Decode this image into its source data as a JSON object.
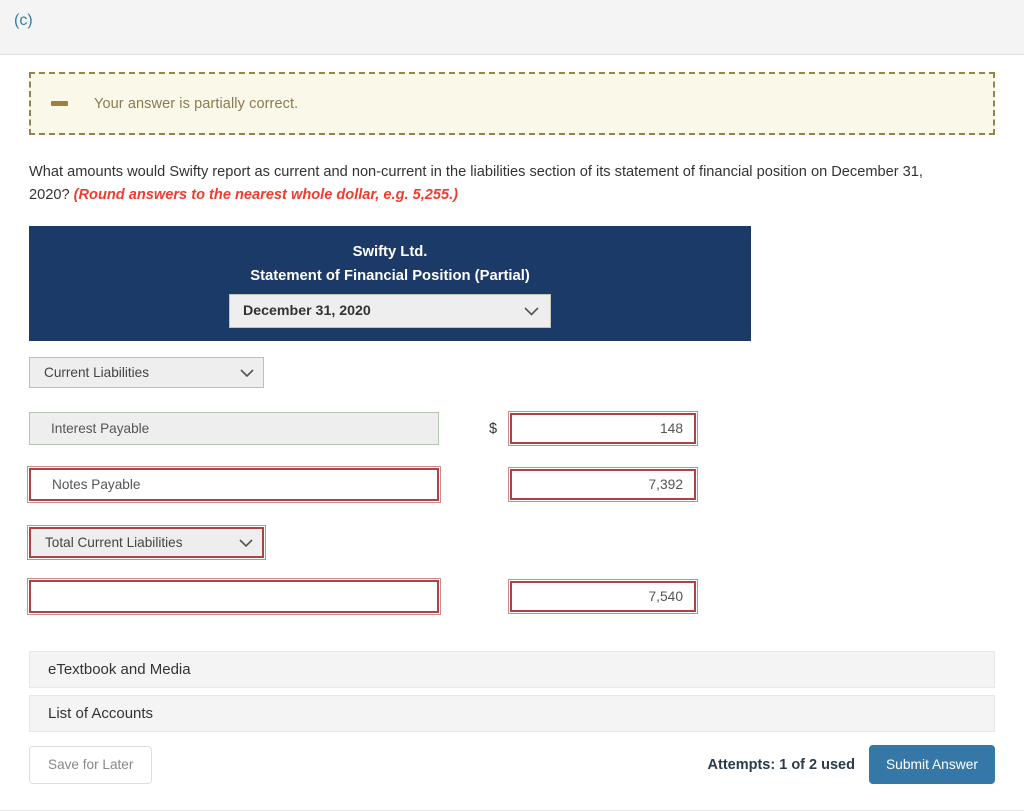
{
  "part_label": "(c)",
  "alert": {
    "icon": "minus-icon",
    "message": "Your answer is partially correct.",
    "border_color": "#96854b",
    "background_color": "#faf8e8"
  },
  "question": {
    "text": "What amounts would Swifty report as current and non-current in the liabilities section of its statement of financial position on December 31, 2020? ",
    "emphasis": "(Round answers to the nearest whole dollar, e.g. 5,255.)",
    "emphasis_color": "#ef3c2d"
  },
  "statement": {
    "company": "Swifty Ltd.",
    "title": "Statement of Financial Position (Partial)",
    "header_color": "#1b3a68",
    "date_select": {
      "value": "December 31, 2020",
      "icon": "chevron-down-icon"
    }
  },
  "form": {
    "section_select": {
      "value": "Current Liabilities",
      "status": "correct",
      "icon": "chevron-down-icon"
    },
    "rows": [
      {
        "label": "Interest Payable",
        "label_status": "correct",
        "label_type": "text",
        "dollar_sign": "$",
        "amount": "148",
        "amount_status": "incorrect"
      },
      {
        "label": "Notes Payable",
        "label_status": "incorrect",
        "label_type": "text",
        "dollar_sign": "",
        "amount": "7,392",
        "amount_status": "incorrect"
      }
    ],
    "total_select": {
      "value": "Total Current Liabilities",
      "status": "incorrect",
      "icon": "chevron-down-icon"
    },
    "total_row": {
      "label": "",
      "label_status": "incorrect",
      "dollar_sign": "",
      "amount": "7,540",
      "amount_status": "incorrect"
    },
    "correct_border_color": "#b4c6ae",
    "incorrect_border_color": "#a94442"
  },
  "accordion": [
    {
      "label": "eTextbook and Media"
    },
    {
      "label": "List of Accounts"
    }
  ],
  "footer": {
    "save_label": "Save for Later",
    "attempts": "Attempts: 1 of 2 used",
    "submit_label": "Submit Answer",
    "submit_color": "#3578a8"
  }
}
